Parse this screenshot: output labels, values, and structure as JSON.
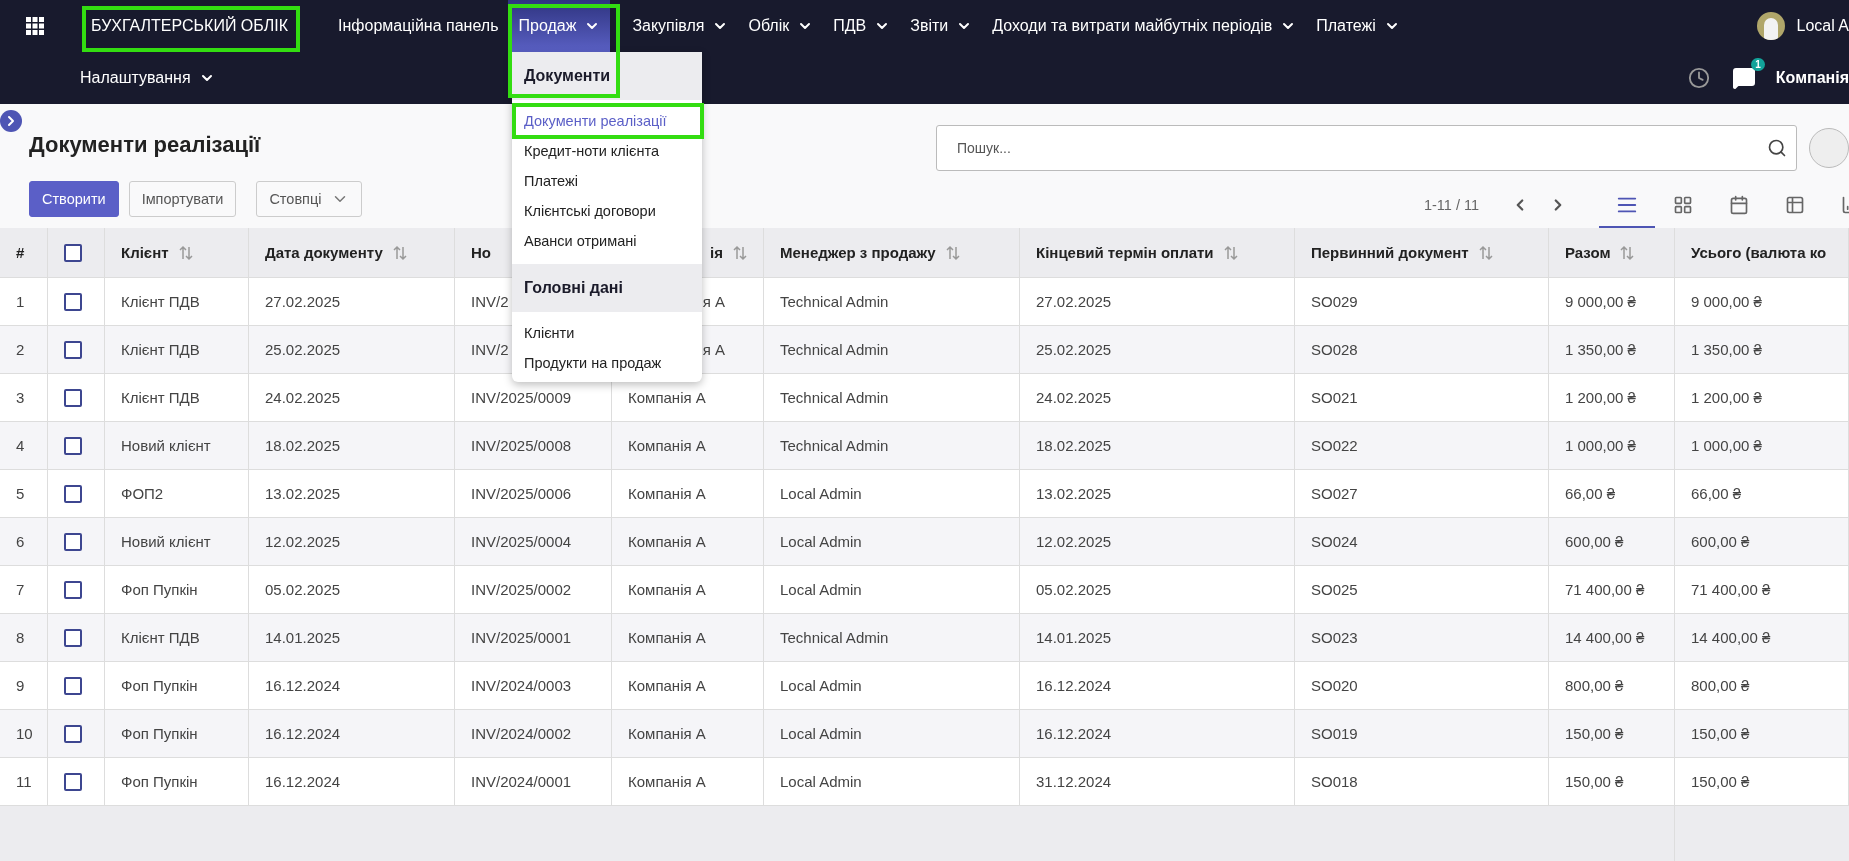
{
  "navbar": {
    "brand": {
      "text": "БУХГАЛТЕРСЬКИЙ ОБЛІК",
      "highlighted": true
    },
    "menu": [
      {
        "label": "Інформаційна панель",
        "dropdown": false,
        "selected": false,
        "highlighted": false
      },
      {
        "label": "Продаж",
        "dropdown": true,
        "selected": true,
        "highlighted": true
      },
      {
        "label": "Закупівля",
        "dropdown": true,
        "selected": false,
        "highlighted": false
      },
      {
        "label": "Облік",
        "dropdown": true,
        "selected": false,
        "highlighted": false
      },
      {
        "label": "ПДВ",
        "dropdown": true,
        "selected": false,
        "highlighted": false
      },
      {
        "label": "Звіти",
        "dropdown": true,
        "selected": false,
        "highlighted": false
      },
      {
        "label": "Доходи та витрати майбутніх періодів",
        "dropdown": true,
        "selected": false,
        "highlighted": false
      },
      {
        "label": "Платежі",
        "dropdown": true,
        "selected": false,
        "highlighted": false
      }
    ],
    "menu_row_2": [
      {
        "label": "Налаштування",
        "dropdown": true
      }
    ],
    "user": "Local A",
    "chat_badge": "1",
    "company": "Компанія"
  },
  "dropdown": {
    "sections": [
      {
        "title": "Документи",
        "items": [
          {
            "label": "Документи реалізації",
            "selected": true,
            "highlighted": true
          },
          {
            "label": "Кредит-ноти клієнта",
            "selected": false,
            "highlighted": false
          },
          {
            "label": "Платежі",
            "selected": false,
            "highlighted": false
          },
          {
            "label": "Клієнтські договори",
            "selected": false,
            "highlighted": false
          },
          {
            "label": "Аванси отримані",
            "selected": false,
            "highlighted": false
          }
        ]
      },
      {
        "title": "Головні дані",
        "items": [
          {
            "label": "Клієнти",
            "selected": false,
            "highlighted": false
          },
          {
            "label": "Продукти на продаж",
            "selected": false,
            "highlighted": false
          }
        ]
      }
    ]
  },
  "page": {
    "title": "Документи реалізації",
    "search": {
      "placeholder": "Пошук..."
    },
    "buttons": [
      {
        "label": "Створити",
        "kind": "primary"
      },
      {
        "label": "Імпортувати",
        "kind": "secondary"
      },
      {
        "label": "Стовпці",
        "kind": "dropdown"
      }
    ],
    "pager": "1-11 / 11",
    "views": [
      {
        "kind": "list",
        "selected": true
      },
      {
        "kind": "kanban",
        "selected": false
      },
      {
        "kind": "calendar",
        "selected": false
      },
      {
        "kind": "pivot",
        "selected": false
      },
      {
        "kind": "graph",
        "selected": false
      }
    ]
  },
  "table": {
    "number_header": "#",
    "select_all": {
      "checked": false
    },
    "columns": [
      {
        "kind": "text",
        "label": "Клієнт",
        "sortable": true
      },
      {
        "kind": "text",
        "label": "Дата документу",
        "sortable": true
      },
      {
        "kind": "text",
        "label": "Но",
        "sortable": false
      },
      {
        "kind": "clipped",
        "label": "ія",
        "sortable": true
      },
      {
        "kind": "text",
        "label": "Менеджер з продажу",
        "sortable": true
      },
      {
        "kind": "text",
        "label": "Кінцевий термін оплати",
        "sortable": true
      },
      {
        "kind": "text",
        "label": "Первинний документ",
        "sortable": true
      },
      {
        "kind": "text",
        "label": "Разом",
        "sortable": true
      },
      {
        "kind": "text",
        "label": "Усього (валюта ко",
        "sortable": false
      }
    ],
    "rows": [
      {
        "number": "1",
        "checked": false,
        "covered": true,
        "cells": [
          "Клієнт ПДВ",
          "27.02.2025",
          "INV/2",
          "я А",
          "Technical Admin",
          "27.02.2025",
          "SO029",
          "9 000,00 ₴",
          "9 000,00 ₴"
        ]
      },
      {
        "number": "2",
        "checked": false,
        "covered": true,
        "cells": [
          "Клієнт ПДВ",
          "25.02.2025",
          "INV/2",
          "я А",
          "Technical Admin",
          "25.02.2025",
          "SO028",
          "1 350,00 ₴",
          "1 350,00 ₴"
        ]
      },
      {
        "number": "3",
        "checked": false,
        "covered": false,
        "cells": [
          "Клієнт ПДВ",
          "24.02.2025",
          "INV/2025/0009",
          "Компанія А",
          "Technical Admin",
          "24.02.2025",
          "SO021",
          "1 200,00 ₴",
          "1 200,00 ₴"
        ]
      },
      {
        "number": "4",
        "checked": false,
        "covered": false,
        "cells": [
          "Новий клієнт",
          "18.02.2025",
          "INV/2025/0008",
          "Компанія А",
          "Technical Admin",
          "18.02.2025",
          "SO022",
          "1 000,00 ₴",
          "1 000,00 ₴"
        ]
      },
      {
        "number": "5",
        "checked": false,
        "covered": false,
        "cells": [
          "ФОП2",
          "13.02.2025",
          "INV/2025/0006",
          "Компанія А",
          "Local Admin",
          "13.02.2025",
          "SO027",
          "66,00 ₴",
          "66,00 ₴"
        ]
      },
      {
        "number": "6",
        "checked": false,
        "covered": false,
        "cells": [
          "Новий клієнт",
          "12.02.2025",
          "INV/2025/0004",
          "Компанія А",
          "Local Admin",
          "12.02.2025",
          "SO024",
          "600,00 ₴",
          "600,00 ₴"
        ]
      },
      {
        "number": "7",
        "checked": false,
        "covered": false,
        "cells": [
          "Фоп Пупкін",
          "05.02.2025",
          "INV/2025/0002",
          "Компанія А",
          "Local Admin",
          "05.02.2025",
          "SO025",
          "71 400,00 ₴",
          "71 400,00 ₴"
        ]
      },
      {
        "number": "8",
        "checked": false,
        "covered": false,
        "cells": [
          "Клієнт ПДВ",
          "14.01.2025",
          "INV/2025/0001",
          "Компанія А",
          "Technical Admin",
          "14.01.2025",
          "SO023",
          "14 400,00 ₴",
          "14 400,00 ₴"
        ]
      },
      {
        "number": "9",
        "checked": false,
        "covered": false,
        "cells": [
          "Фоп Пупкін",
          "16.12.2024",
          "INV/2024/0003",
          "Компанія А",
          "Local Admin",
          "16.12.2024",
          "SO020",
          "800,00 ₴",
          "800,00 ₴"
        ]
      },
      {
        "number": "10",
        "checked": false,
        "covered": false,
        "cells": [
          "Фоп Пупкін",
          "16.12.2024",
          "INV/2024/0002",
          "Компанія А",
          "Local Admin",
          "16.12.2024",
          "SO019",
          "150,00 ₴",
          "150,00 ₴"
        ]
      },
      {
        "number": "11",
        "checked": false,
        "covered": false,
        "cells": [
          "Фоп Пупкін",
          "16.12.2024",
          "INV/2024/0001",
          "Компанія А",
          "Local Admin",
          "31.12.2024",
          "SO018",
          "150,00 ₴",
          "150,00 ₴"
        ]
      }
    ]
  }
}
